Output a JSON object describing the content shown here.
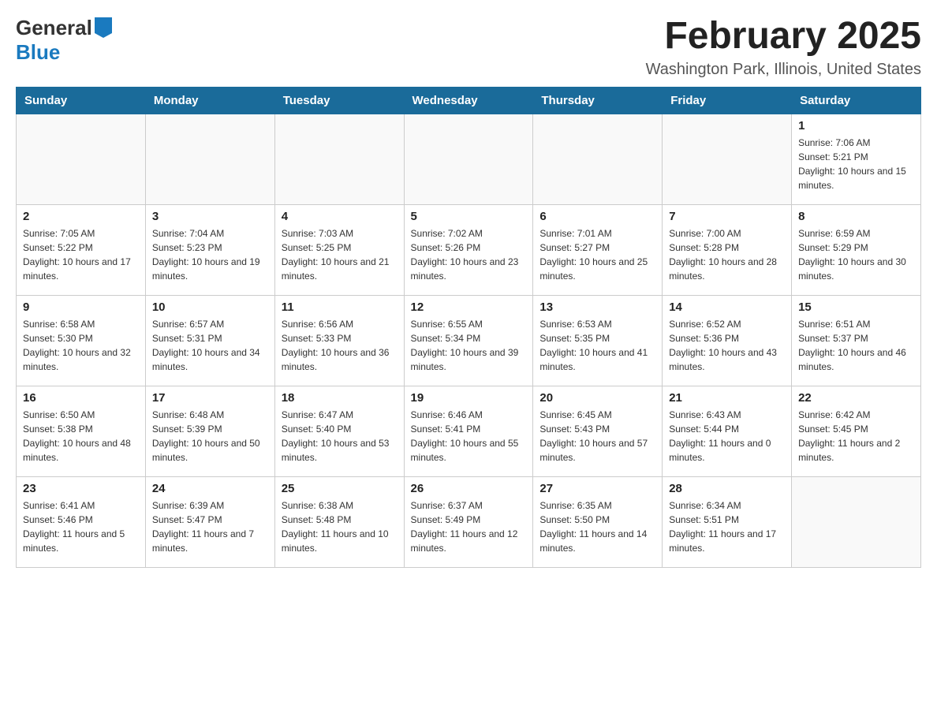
{
  "header": {
    "logo_general": "General",
    "logo_blue": "Blue",
    "month_title": "February 2025",
    "location": "Washington Park, Illinois, United States"
  },
  "days_of_week": [
    "Sunday",
    "Monday",
    "Tuesday",
    "Wednesday",
    "Thursday",
    "Friday",
    "Saturday"
  ],
  "weeks": [
    [
      {
        "day": "",
        "sunrise": "",
        "sunset": "",
        "daylight": ""
      },
      {
        "day": "",
        "sunrise": "",
        "sunset": "",
        "daylight": ""
      },
      {
        "day": "",
        "sunrise": "",
        "sunset": "",
        "daylight": ""
      },
      {
        "day": "",
        "sunrise": "",
        "sunset": "",
        "daylight": ""
      },
      {
        "day": "",
        "sunrise": "",
        "sunset": "",
        "daylight": ""
      },
      {
        "day": "",
        "sunrise": "",
        "sunset": "",
        "daylight": ""
      },
      {
        "day": "1",
        "sunrise": "Sunrise: 7:06 AM",
        "sunset": "Sunset: 5:21 PM",
        "daylight": "Daylight: 10 hours and 15 minutes."
      }
    ],
    [
      {
        "day": "2",
        "sunrise": "Sunrise: 7:05 AM",
        "sunset": "Sunset: 5:22 PM",
        "daylight": "Daylight: 10 hours and 17 minutes."
      },
      {
        "day": "3",
        "sunrise": "Sunrise: 7:04 AM",
        "sunset": "Sunset: 5:23 PM",
        "daylight": "Daylight: 10 hours and 19 minutes."
      },
      {
        "day": "4",
        "sunrise": "Sunrise: 7:03 AM",
        "sunset": "Sunset: 5:25 PM",
        "daylight": "Daylight: 10 hours and 21 minutes."
      },
      {
        "day": "5",
        "sunrise": "Sunrise: 7:02 AM",
        "sunset": "Sunset: 5:26 PM",
        "daylight": "Daylight: 10 hours and 23 minutes."
      },
      {
        "day": "6",
        "sunrise": "Sunrise: 7:01 AM",
        "sunset": "Sunset: 5:27 PM",
        "daylight": "Daylight: 10 hours and 25 minutes."
      },
      {
        "day": "7",
        "sunrise": "Sunrise: 7:00 AM",
        "sunset": "Sunset: 5:28 PM",
        "daylight": "Daylight: 10 hours and 28 minutes."
      },
      {
        "day": "8",
        "sunrise": "Sunrise: 6:59 AM",
        "sunset": "Sunset: 5:29 PM",
        "daylight": "Daylight: 10 hours and 30 minutes."
      }
    ],
    [
      {
        "day": "9",
        "sunrise": "Sunrise: 6:58 AM",
        "sunset": "Sunset: 5:30 PM",
        "daylight": "Daylight: 10 hours and 32 minutes."
      },
      {
        "day": "10",
        "sunrise": "Sunrise: 6:57 AM",
        "sunset": "Sunset: 5:31 PM",
        "daylight": "Daylight: 10 hours and 34 minutes."
      },
      {
        "day": "11",
        "sunrise": "Sunrise: 6:56 AM",
        "sunset": "Sunset: 5:33 PM",
        "daylight": "Daylight: 10 hours and 36 minutes."
      },
      {
        "day": "12",
        "sunrise": "Sunrise: 6:55 AM",
        "sunset": "Sunset: 5:34 PM",
        "daylight": "Daylight: 10 hours and 39 minutes."
      },
      {
        "day": "13",
        "sunrise": "Sunrise: 6:53 AM",
        "sunset": "Sunset: 5:35 PM",
        "daylight": "Daylight: 10 hours and 41 minutes."
      },
      {
        "day": "14",
        "sunrise": "Sunrise: 6:52 AM",
        "sunset": "Sunset: 5:36 PM",
        "daylight": "Daylight: 10 hours and 43 minutes."
      },
      {
        "day": "15",
        "sunrise": "Sunrise: 6:51 AM",
        "sunset": "Sunset: 5:37 PM",
        "daylight": "Daylight: 10 hours and 46 minutes."
      }
    ],
    [
      {
        "day": "16",
        "sunrise": "Sunrise: 6:50 AM",
        "sunset": "Sunset: 5:38 PM",
        "daylight": "Daylight: 10 hours and 48 minutes."
      },
      {
        "day": "17",
        "sunrise": "Sunrise: 6:48 AM",
        "sunset": "Sunset: 5:39 PM",
        "daylight": "Daylight: 10 hours and 50 minutes."
      },
      {
        "day": "18",
        "sunrise": "Sunrise: 6:47 AM",
        "sunset": "Sunset: 5:40 PM",
        "daylight": "Daylight: 10 hours and 53 minutes."
      },
      {
        "day": "19",
        "sunrise": "Sunrise: 6:46 AM",
        "sunset": "Sunset: 5:41 PM",
        "daylight": "Daylight: 10 hours and 55 minutes."
      },
      {
        "day": "20",
        "sunrise": "Sunrise: 6:45 AM",
        "sunset": "Sunset: 5:43 PM",
        "daylight": "Daylight: 10 hours and 57 minutes."
      },
      {
        "day": "21",
        "sunrise": "Sunrise: 6:43 AM",
        "sunset": "Sunset: 5:44 PM",
        "daylight": "Daylight: 11 hours and 0 minutes."
      },
      {
        "day": "22",
        "sunrise": "Sunrise: 6:42 AM",
        "sunset": "Sunset: 5:45 PM",
        "daylight": "Daylight: 11 hours and 2 minutes."
      }
    ],
    [
      {
        "day": "23",
        "sunrise": "Sunrise: 6:41 AM",
        "sunset": "Sunset: 5:46 PM",
        "daylight": "Daylight: 11 hours and 5 minutes."
      },
      {
        "day": "24",
        "sunrise": "Sunrise: 6:39 AM",
        "sunset": "Sunset: 5:47 PM",
        "daylight": "Daylight: 11 hours and 7 minutes."
      },
      {
        "day": "25",
        "sunrise": "Sunrise: 6:38 AM",
        "sunset": "Sunset: 5:48 PM",
        "daylight": "Daylight: 11 hours and 10 minutes."
      },
      {
        "day": "26",
        "sunrise": "Sunrise: 6:37 AM",
        "sunset": "Sunset: 5:49 PM",
        "daylight": "Daylight: 11 hours and 12 minutes."
      },
      {
        "day": "27",
        "sunrise": "Sunrise: 6:35 AM",
        "sunset": "Sunset: 5:50 PM",
        "daylight": "Daylight: 11 hours and 14 minutes."
      },
      {
        "day": "28",
        "sunrise": "Sunrise: 6:34 AM",
        "sunset": "Sunset: 5:51 PM",
        "daylight": "Daylight: 11 hours and 17 minutes."
      },
      {
        "day": "",
        "sunrise": "",
        "sunset": "",
        "daylight": ""
      }
    ]
  ]
}
